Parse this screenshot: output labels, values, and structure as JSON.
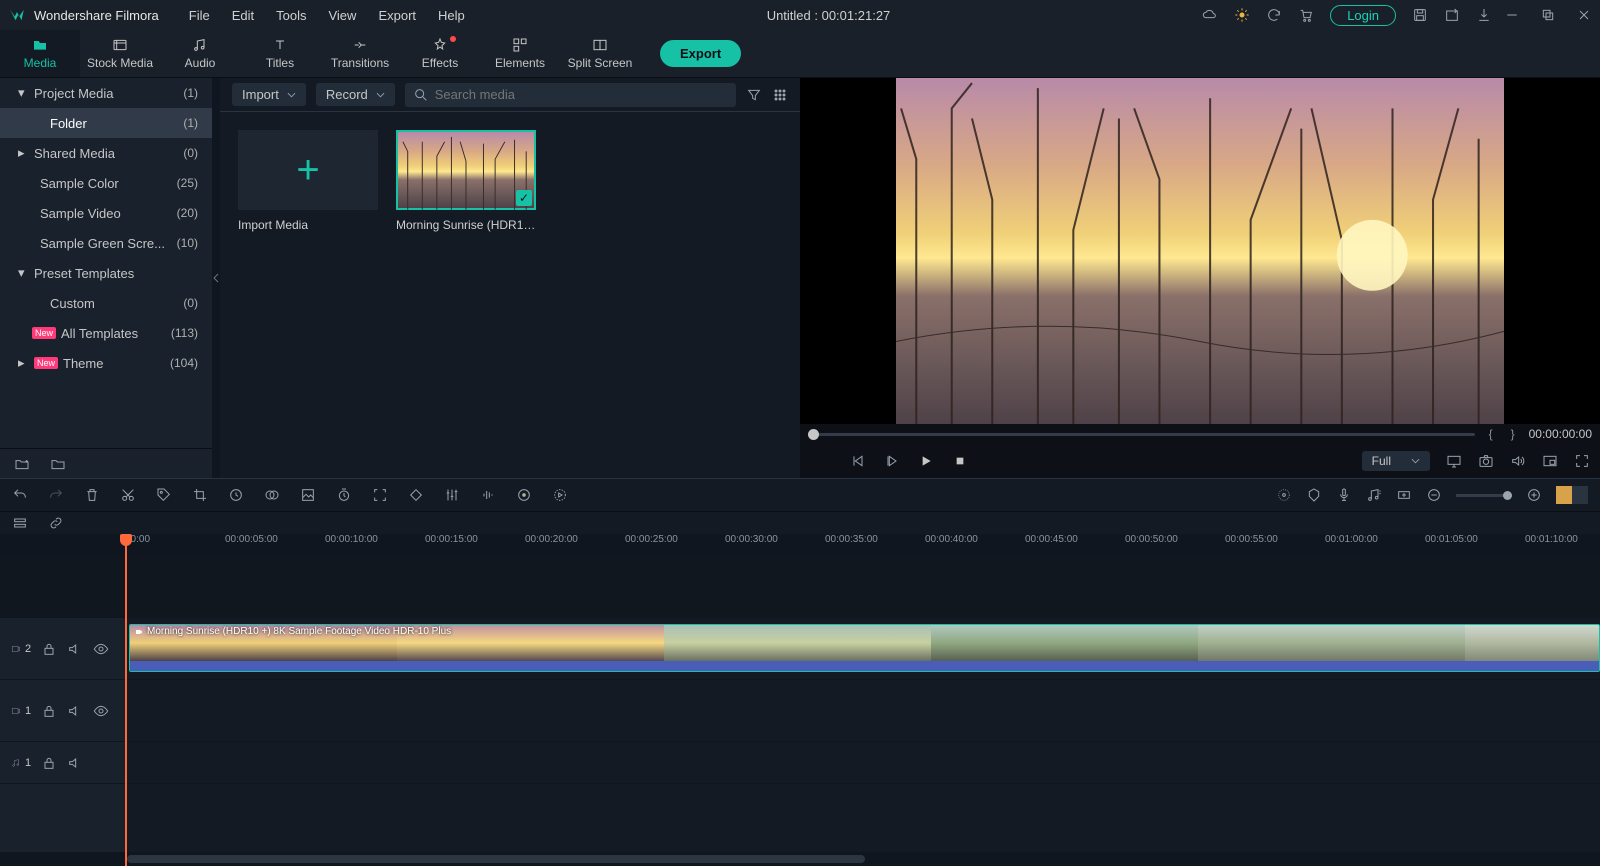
{
  "app": {
    "title": "Wondershare Filmora",
    "header": "Untitled : 00:01:21:27",
    "login": "Login"
  },
  "menu": [
    "File",
    "Edit",
    "Tools",
    "View",
    "Export",
    "Help"
  ],
  "tabs": [
    {
      "label": "Media",
      "active": true
    },
    {
      "label": "Stock Media"
    },
    {
      "label": "Audio"
    },
    {
      "label": "Titles"
    },
    {
      "label": "Transitions"
    },
    {
      "label": "Effects",
      "dot": true
    },
    {
      "label": "Elements"
    },
    {
      "label": "Split Screen"
    }
  ],
  "export_btn": "Export",
  "sidebar": [
    {
      "label": "Project Media",
      "count": "(1)",
      "arrow": "down",
      "indent": 0
    },
    {
      "label": "Folder",
      "count": "(1)",
      "indent": 1,
      "selected": true
    },
    {
      "label": "Shared Media",
      "count": "(0)",
      "arrow": "right",
      "indent": 0
    },
    {
      "label": "Sample Color",
      "count": "(25)",
      "indent": 0,
      "pad": true
    },
    {
      "label": "Sample Video",
      "count": "(20)",
      "indent": 0,
      "pad": true
    },
    {
      "label": "Sample Green Scre...",
      "count": "(10)",
      "indent": 0,
      "pad": true
    },
    {
      "label": "Preset Templates",
      "count": "",
      "arrow": "down",
      "indent": 0
    },
    {
      "label": "Custom",
      "count": "(0)",
      "indent": 1
    },
    {
      "label": "All Templates",
      "count": "(113)",
      "indent": 0,
      "new": true,
      "pad": true
    },
    {
      "label": "Theme",
      "count": "(104)",
      "arrow": "right",
      "indent": 0,
      "new": true
    }
  ],
  "media_toolbar": {
    "import": "Import",
    "record": "Record",
    "search_placeholder": "Search media"
  },
  "media_cards": [
    {
      "label": "Import Media",
      "plus": true
    },
    {
      "label": "Morning Sunrise (HDR10...",
      "selected": true
    }
  ],
  "preview": {
    "time": "00:00:00:00",
    "quality": "Full"
  },
  "ruler": [
    "00:00",
    "00:00:05:00",
    "00:00:10:00",
    "00:00:15:00",
    "00:00:20:00",
    "00:00:25:00",
    "00:00:30:00",
    "00:00:35:00",
    "00:00:40:00",
    "00:00:45:00",
    "00:00:50:00",
    "00:00:55:00",
    "00:01:00:00",
    "00:01:05:00",
    "00:01:10:00"
  ],
  "tracks": {
    "v2": "2",
    "v1": "1",
    "a1": "1"
  },
  "clip_title": "Morning Sunrise (HDR10 +) 8K Sample Footage Video HDR-10 Plus"
}
